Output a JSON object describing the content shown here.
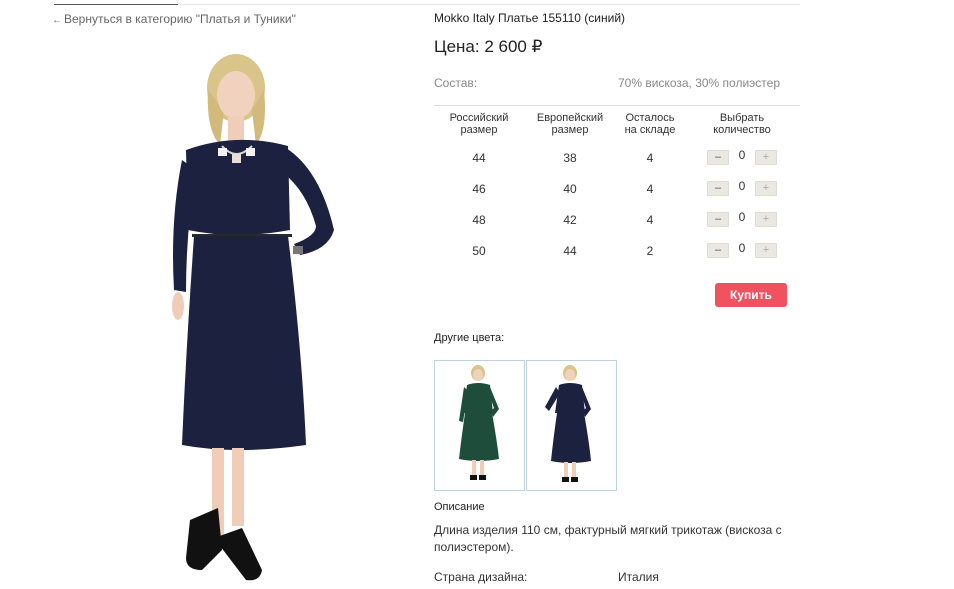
{
  "nav": {
    "back_link": "Вернуться в категорию \"Платья и Туники\"",
    "back_arrow": "←"
  },
  "product": {
    "title": "Mokko Italy Платье 155110 (синий)",
    "price": "Цена: 2 600 ₽",
    "composition_label": "Состав:",
    "composition_value": "70% вискоза, 30% полиэстер"
  },
  "sizes": {
    "headers": {
      "ru_line1": "Российский",
      "ru_line2": "размер",
      "eu_line1": "Европейский",
      "eu_line2": "размер",
      "stock_line1": "Осталось",
      "stock_line2": "на складе",
      "qty_line1": "Выбрать",
      "qty_line2": "количество"
    },
    "rows": [
      {
        "ru": "44",
        "eu": "38",
        "stock": "4",
        "qty": "0"
      },
      {
        "ru": "46",
        "eu": "40",
        "stock": "4",
        "qty": "0"
      },
      {
        "ru": "48",
        "eu": "42",
        "stock": "4",
        "qty": "0"
      },
      {
        "ru": "50",
        "eu": "44",
        "stock": "2",
        "qty": "0"
      }
    ],
    "minus": "–",
    "plus": "+"
  },
  "buy_button": "Купить",
  "other_colors": {
    "label": "Другие цвета:",
    "variants": [
      {
        "icon": "green-dress-photo",
        "color": "#1f4d3c"
      },
      {
        "icon": "navy-dress-photo",
        "color": "#1c2140"
      }
    ]
  },
  "description": {
    "label": "Описание",
    "text": "Длина изделия 110 см, фактурный мягкий трикотаж (вискоза с полиэстером)."
  },
  "specs": {
    "country_label": "Страна дизайна:",
    "country_value": "Италия"
  },
  "colors": {
    "accent": "#f0535f",
    "dress": "#1c2140",
    "qty_button": "#ebe7e2"
  }
}
